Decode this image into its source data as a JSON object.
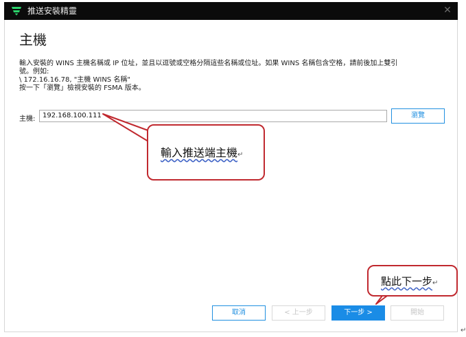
{
  "window": {
    "title": "推送安裝精靈",
    "close_glyph": "✕",
    "logo_icon": "shield-logo-icon"
  },
  "page": {
    "title": "主機",
    "desc_line1": "輸入安裝的 WINS 主機名稱或 IP 位址，並且以逗號或空格分隔這些名稱或位址。如果 WINS 名稱包含空格，請前後加上雙引",
    "desc_line2": "號。例如:",
    "desc_line3": "\\ 172.16.16.78, \"主機 WINS 名稱\"",
    "desc_line4": "按一下「瀏覽」檢視安裝的 FSMA 版本。"
  },
  "host": {
    "label": "主機:",
    "value": "192.168.100.111"
  },
  "buttons": {
    "browse": "瀏覽",
    "cancel": "取消",
    "prev": "< 上一步",
    "next": "下一步 >",
    "start": "開始"
  },
  "callouts": {
    "host_text": "輸入推送端主機",
    "next_text": "點此下一步",
    "enter_mark": "↵",
    "color": "#c0282e"
  },
  "colors": {
    "accent": "#1a8ce6",
    "titlebar": "#0b0b0b",
    "logo": "#2bd36b"
  }
}
